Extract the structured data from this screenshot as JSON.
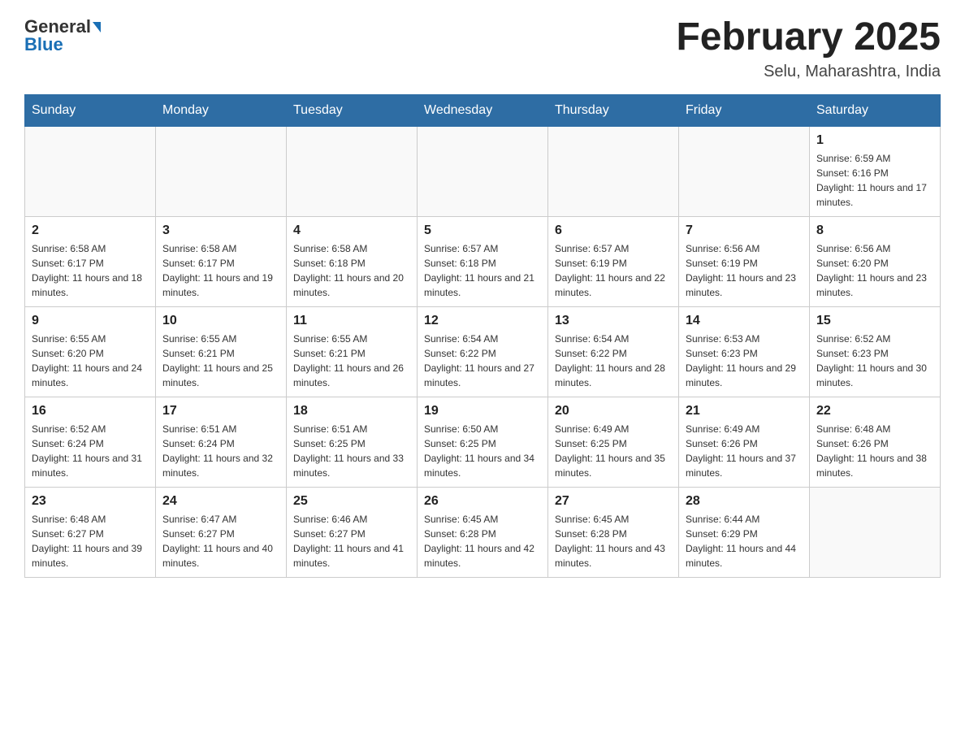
{
  "header": {
    "logo_general": "General",
    "logo_blue": "Blue",
    "month_title": "February 2025",
    "location": "Selu, Maharashtra, India"
  },
  "days_of_week": [
    "Sunday",
    "Monday",
    "Tuesday",
    "Wednesday",
    "Thursday",
    "Friday",
    "Saturday"
  ],
  "weeks": [
    {
      "days": [
        {
          "number": "",
          "info": ""
        },
        {
          "number": "",
          "info": ""
        },
        {
          "number": "",
          "info": ""
        },
        {
          "number": "",
          "info": ""
        },
        {
          "number": "",
          "info": ""
        },
        {
          "number": "",
          "info": ""
        },
        {
          "number": "1",
          "info": "Sunrise: 6:59 AM\nSunset: 6:16 PM\nDaylight: 11 hours and 17 minutes."
        }
      ]
    },
    {
      "days": [
        {
          "number": "2",
          "info": "Sunrise: 6:58 AM\nSunset: 6:17 PM\nDaylight: 11 hours and 18 minutes."
        },
        {
          "number": "3",
          "info": "Sunrise: 6:58 AM\nSunset: 6:17 PM\nDaylight: 11 hours and 19 minutes."
        },
        {
          "number": "4",
          "info": "Sunrise: 6:58 AM\nSunset: 6:18 PM\nDaylight: 11 hours and 20 minutes."
        },
        {
          "number": "5",
          "info": "Sunrise: 6:57 AM\nSunset: 6:18 PM\nDaylight: 11 hours and 21 minutes."
        },
        {
          "number": "6",
          "info": "Sunrise: 6:57 AM\nSunset: 6:19 PM\nDaylight: 11 hours and 22 minutes."
        },
        {
          "number": "7",
          "info": "Sunrise: 6:56 AM\nSunset: 6:19 PM\nDaylight: 11 hours and 23 minutes."
        },
        {
          "number": "8",
          "info": "Sunrise: 6:56 AM\nSunset: 6:20 PM\nDaylight: 11 hours and 23 minutes."
        }
      ]
    },
    {
      "days": [
        {
          "number": "9",
          "info": "Sunrise: 6:55 AM\nSunset: 6:20 PM\nDaylight: 11 hours and 24 minutes."
        },
        {
          "number": "10",
          "info": "Sunrise: 6:55 AM\nSunset: 6:21 PM\nDaylight: 11 hours and 25 minutes."
        },
        {
          "number": "11",
          "info": "Sunrise: 6:55 AM\nSunset: 6:21 PM\nDaylight: 11 hours and 26 minutes."
        },
        {
          "number": "12",
          "info": "Sunrise: 6:54 AM\nSunset: 6:22 PM\nDaylight: 11 hours and 27 minutes."
        },
        {
          "number": "13",
          "info": "Sunrise: 6:54 AM\nSunset: 6:22 PM\nDaylight: 11 hours and 28 minutes."
        },
        {
          "number": "14",
          "info": "Sunrise: 6:53 AM\nSunset: 6:23 PM\nDaylight: 11 hours and 29 minutes."
        },
        {
          "number": "15",
          "info": "Sunrise: 6:52 AM\nSunset: 6:23 PM\nDaylight: 11 hours and 30 minutes."
        }
      ]
    },
    {
      "days": [
        {
          "number": "16",
          "info": "Sunrise: 6:52 AM\nSunset: 6:24 PM\nDaylight: 11 hours and 31 minutes."
        },
        {
          "number": "17",
          "info": "Sunrise: 6:51 AM\nSunset: 6:24 PM\nDaylight: 11 hours and 32 minutes."
        },
        {
          "number": "18",
          "info": "Sunrise: 6:51 AM\nSunset: 6:25 PM\nDaylight: 11 hours and 33 minutes."
        },
        {
          "number": "19",
          "info": "Sunrise: 6:50 AM\nSunset: 6:25 PM\nDaylight: 11 hours and 34 minutes."
        },
        {
          "number": "20",
          "info": "Sunrise: 6:49 AM\nSunset: 6:25 PM\nDaylight: 11 hours and 35 minutes."
        },
        {
          "number": "21",
          "info": "Sunrise: 6:49 AM\nSunset: 6:26 PM\nDaylight: 11 hours and 37 minutes."
        },
        {
          "number": "22",
          "info": "Sunrise: 6:48 AM\nSunset: 6:26 PM\nDaylight: 11 hours and 38 minutes."
        }
      ]
    },
    {
      "days": [
        {
          "number": "23",
          "info": "Sunrise: 6:48 AM\nSunset: 6:27 PM\nDaylight: 11 hours and 39 minutes."
        },
        {
          "number": "24",
          "info": "Sunrise: 6:47 AM\nSunset: 6:27 PM\nDaylight: 11 hours and 40 minutes."
        },
        {
          "number": "25",
          "info": "Sunrise: 6:46 AM\nSunset: 6:27 PM\nDaylight: 11 hours and 41 minutes."
        },
        {
          "number": "26",
          "info": "Sunrise: 6:45 AM\nSunset: 6:28 PM\nDaylight: 11 hours and 42 minutes."
        },
        {
          "number": "27",
          "info": "Sunrise: 6:45 AM\nSunset: 6:28 PM\nDaylight: 11 hours and 43 minutes."
        },
        {
          "number": "28",
          "info": "Sunrise: 6:44 AM\nSunset: 6:29 PM\nDaylight: 11 hours and 44 minutes."
        },
        {
          "number": "",
          "info": ""
        }
      ]
    }
  ]
}
